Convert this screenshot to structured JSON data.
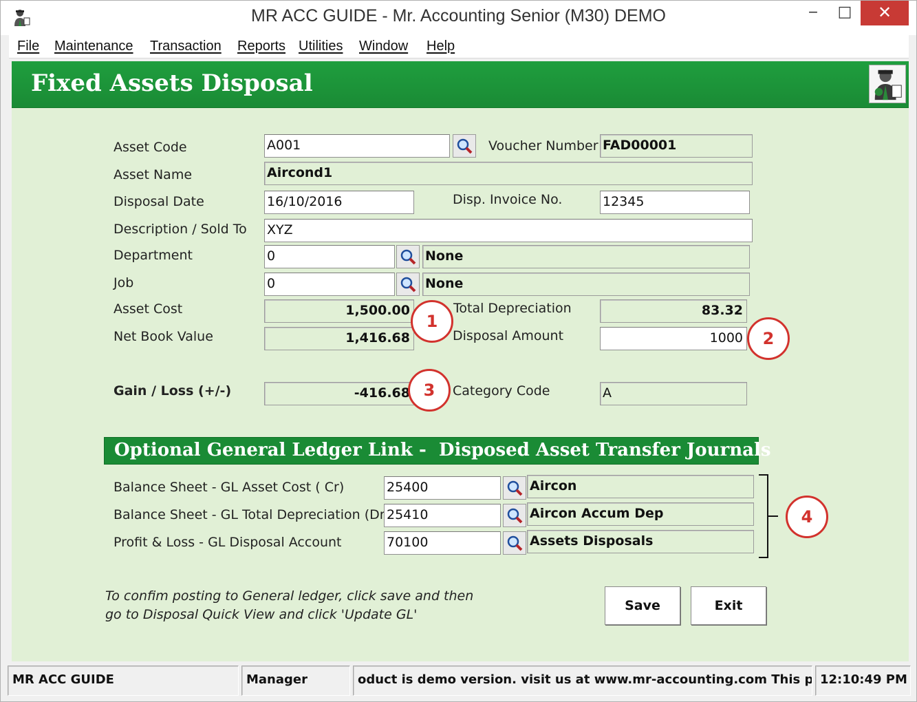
{
  "window": {
    "title": "MR ACC GUIDE - Mr. Accounting Senior (M30) DEMO",
    "minimize_glyph": "‒",
    "maximize_glyph": "□",
    "close_glyph": "✕"
  },
  "menu": [
    "File",
    "Maintenance",
    "Transaction",
    "Reports",
    "Utilities",
    "Window",
    "Help"
  ],
  "form": {
    "title": "Fixed Assets Disposal",
    "asset_code": {
      "label": "Asset Code",
      "value": "A001"
    },
    "voucher_number": {
      "label": "Voucher Number",
      "value": "FAD00001"
    },
    "asset_name": {
      "label": "Asset Name",
      "value": "Aircond1"
    },
    "disposal_date": {
      "label": "Disposal Date",
      "value": "16/10/2016"
    },
    "disp_invoice_no": {
      "label": "Disp. Invoice No.",
      "value": "12345"
    },
    "description": {
      "label": "Description / Sold To",
      "value": "XYZ"
    },
    "department": {
      "label": "Department",
      "value": "0",
      "name": "None"
    },
    "job": {
      "label": "Job",
      "value": "0",
      "name": "None"
    },
    "asset_cost": {
      "label": "Asset Cost",
      "value": "1,500.00"
    },
    "total_depreciation": {
      "label": "Total Depreciation",
      "value": "83.32"
    },
    "net_book_value": {
      "label": "Net Book Value",
      "value": "1,416.68"
    },
    "disposal_amount": {
      "label": "Disposal Amount",
      "value": "1000"
    },
    "gain_loss": {
      "label": "Gain / Loss (+/-)",
      "value": "-416.68"
    },
    "category_code": {
      "label": "Category Code",
      "value": "A"
    }
  },
  "gl_link": {
    "title": "Optional General Ledger Link -  Disposed Asset Transfer Journals",
    "rows": [
      {
        "label": "Balance Sheet - GL Asset Cost ( Cr)",
        "code": "25400",
        "name": "Aircon"
      },
      {
        "label": "Balance Sheet - GL Total Depreciation (Dr)",
        "code": "25410",
        "name": "Aircon Accum Dep"
      },
      {
        "label": "Profit & Loss - GL Disposal Account",
        "code": "70100",
        "name": "Assets Disposals"
      }
    ]
  },
  "note": {
    "line1": "To confim posting to General ledger, click save and then",
    "line2": "go to Disposal Quick View and click 'Update GL'"
  },
  "buttons": {
    "save": "Save",
    "exit": "Exit"
  },
  "callouts": [
    "1",
    "2",
    "3",
    "4"
  ],
  "statusbar": {
    "app": "MR ACC GUIDE",
    "user": "Manager",
    "message": "oduct is demo version.  visit us at www.mr-accounting.com This pr",
    "time": "12:10:49 PM"
  },
  "colors": {
    "header_green": "#1f9e3e",
    "panel_bg": "#e1f0d6",
    "callout_red": "#d2322d",
    "close_red": "#c83a35"
  },
  "icons": [
    "app-icon",
    "magnifier-icon",
    "user-logo-icon"
  ]
}
